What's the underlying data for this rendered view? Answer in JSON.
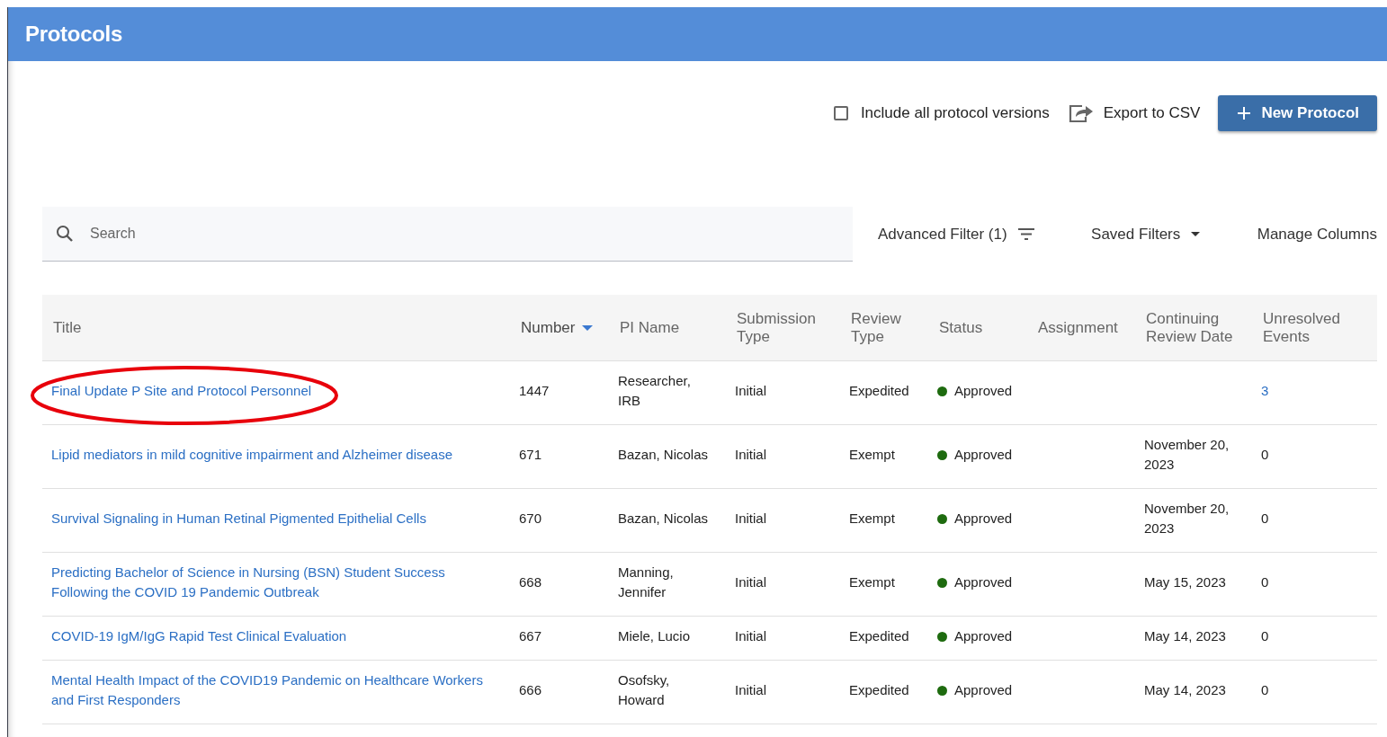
{
  "header": {
    "title": "Protocols"
  },
  "toolbar": {
    "include_versions": {
      "label": "Include all protocol versions",
      "checked": false
    },
    "export": {
      "label": "Export to CSV"
    },
    "new_button": {
      "label": "New Protocol"
    }
  },
  "search": {
    "placeholder": "Search"
  },
  "filters": {
    "advanced": "Advanced Filter (1)",
    "saved": "Saved Filters",
    "manage": "Manage Columns"
  },
  "table": {
    "columns": [
      {
        "label": "Title",
        "sorted": false
      },
      {
        "label": "Number",
        "sorted": true
      },
      {
        "label": "PI Name",
        "sorted": false
      },
      {
        "label": "Submission Type",
        "sorted": false
      },
      {
        "label": "Review Type",
        "sorted": false
      },
      {
        "label": "Status",
        "sorted": false
      },
      {
        "label": "Assignment",
        "sorted": false
      },
      {
        "label": "Continuing Review Date",
        "sorted": false
      },
      {
        "label": "Unresolved Events",
        "sorted": false
      }
    ],
    "rows": [
      {
        "title": "Final Update P Site and Protocol Personnel",
        "circled": true,
        "number": "1447",
        "pi_name": "Researcher, IRB",
        "submission_type": "Initial",
        "review_type": "Expedited",
        "status": "Approved",
        "color": "#1e6b0f",
        "continuing_review_date": "",
        "unresolved_events": "3",
        "events_link": true
      },
      {
        "title": "Lipid mediators in mild cognitive impairment and Alzheimer disease",
        "circled": false,
        "number": "671",
        "pi_name": "Bazan, Nicolas",
        "submission_type": "Initial",
        "review_type": "Exempt",
        "status": "Approved",
        "color": "#1e6b0f",
        "continuing_review_date": "November 20, 2023",
        "unresolved_events": "0",
        "events_link": false
      },
      {
        "title": "Survival Signaling in Human Retinal Pigmented Epithelial Cells",
        "circled": false,
        "number": "670",
        "pi_name": "Bazan, Nicolas",
        "submission_type": "Initial",
        "review_type": "Exempt",
        "status": "Approved",
        "color": "#1e6b0f",
        "continuing_review_date": "November 20, 2023",
        "unresolved_events": "0",
        "events_link": false
      },
      {
        "title": "Predicting Bachelor of Science in Nursing (BSN) Student Success Following the COVID 19 Pandemic Outbreak",
        "circled": false,
        "number": "668",
        "pi_name": "Manning, Jennifer",
        "submission_type": "Initial",
        "review_type": "Exempt",
        "status": "Approved",
        "color": "#1e6b0f",
        "continuing_review_date": "May 15, 2023",
        "unresolved_events": "0",
        "events_link": false
      },
      {
        "title": "COVID-19 IgM/IgG Rapid Test Clinical Evaluation",
        "circled": false,
        "number": "667",
        "pi_name": "Miele, Lucio",
        "submission_type": "Initial",
        "review_type": "Expedited",
        "status": "Approved",
        "color": "#1e6b0f",
        "continuing_review_date": "May 14, 2023",
        "unresolved_events": "0",
        "events_link": false
      },
      {
        "title": "Mental Health Impact of the COVID19 Pandemic on Healthcare Workers and First Responders",
        "circled": false,
        "number": "666",
        "pi_name": "Osofsky, Howard",
        "submission_type": "Initial",
        "review_type": "Expedited",
        "status": "Approved",
        "color": "#1e6b0f",
        "continuing_review_date": "May 14, 2023",
        "unresolved_events": "0",
        "events_link": false
      }
    ]
  }
}
